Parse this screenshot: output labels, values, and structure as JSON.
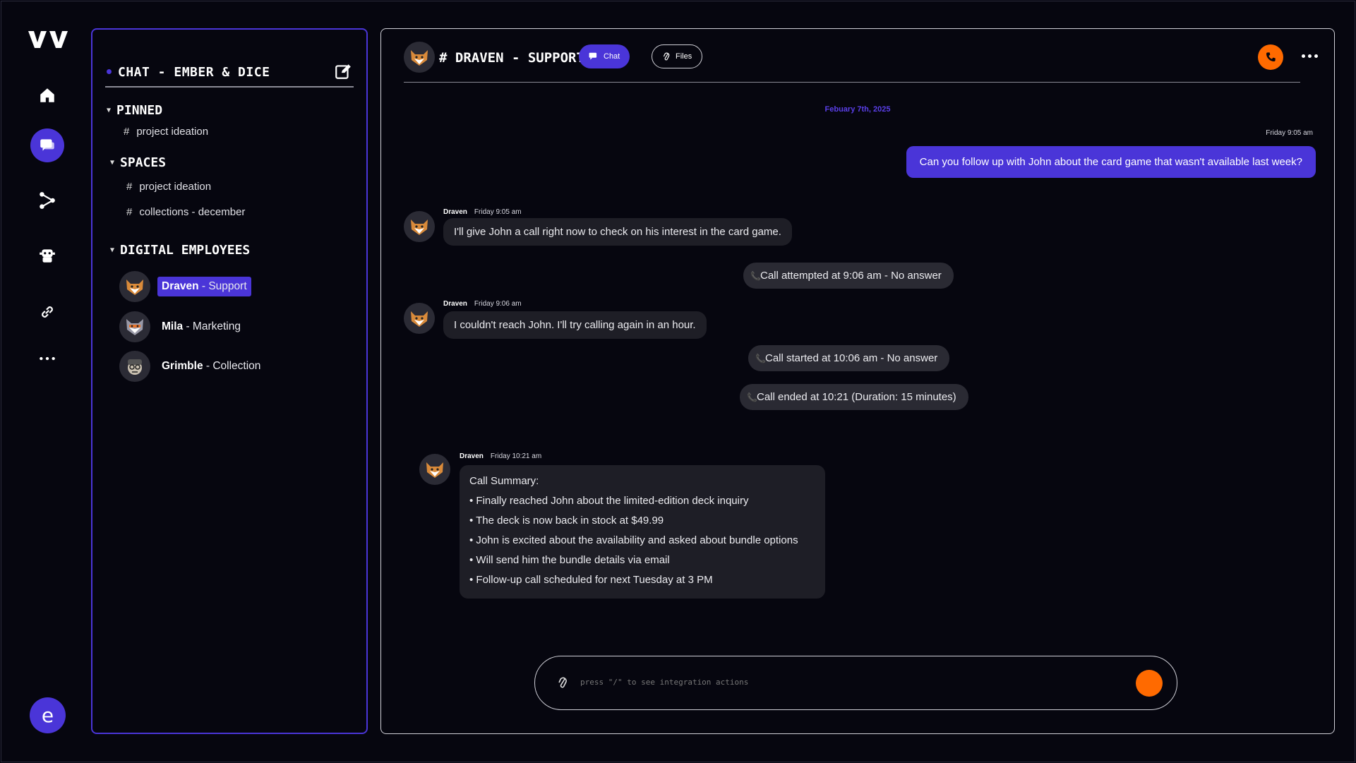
{
  "colors": {
    "accent": "#4a35d8",
    "orange": "#ff6a00",
    "background": "#06060f"
  },
  "rail": {
    "items": [
      {
        "name": "home-icon"
      },
      {
        "name": "chat-icon",
        "active": true
      },
      {
        "name": "share-icon"
      },
      {
        "name": "bot-icon"
      },
      {
        "name": "link-icon"
      },
      {
        "name": "more-icon"
      }
    ],
    "user_initial": "e"
  },
  "sidebar": {
    "title": "Chat - Ember & Dice",
    "pinned": {
      "label": "Pinned",
      "items": [
        "project ideation"
      ]
    },
    "spaces": {
      "label": "Spaces",
      "items": [
        "project ideation",
        "collections - december"
      ]
    },
    "employees": {
      "label": "Digital Employees",
      "items": [
        {
          "name": "Draven",
          "role": " - Support",
          "selected": true
        },
        {
          "name": "Mila",
          "role": " - Marketing"
        },
        {
          "name": "Grimble",
          "role": " - Collection"
        }
      ]
    }
  },
  "main": {
    "channel_title": "# Draven - Support",
    "tabs": {
      "chat": "Chat",
      "files": "Files"
    },
    "date": "Febuary 7th, 2025",
    "outgoing": {
      "time": "Friday 9:05 am",
      "text": "Can you follow up with John about the card game that wasn't available last week?"
    },
    "messages": [
      {
        "author": "Draven",
        "time": "Friday 9:05 am",
        "text": "I'll give John a call right now to check on his interest in the card game."
      },
      {
        "author": "Draven",
        "time": "Friday 9:06 am",
        "text": "I couldn't reach John. I'll try calling again in an hour."
      }
    ],
    "events": [
      "Call attempted at 9:06 am - No answer",
      "Call started at 10:06 am - No answer",
      "Call ended at 10:21 (Duration: 15 minutes)"
    ],
    "summary": {
      "author": "Draven",
      "time": "Friday 10:21 am",
      "title": "Call Summary:",
      "lines": [
        "• Finally reached John about the limited-edition deck inquiry",
        "• The deck is now back in stock at $49.99",
        "• John is excited about the availability and asked about bundle options",
        "• Will send him the bundle details via email",
        "• Follow-up call scheduled for next Tuesday at 3 PM"
      ]
    },
    "composer": {
      "placeholder": "press \"/\" to see integration actions"
    }
  }
}
